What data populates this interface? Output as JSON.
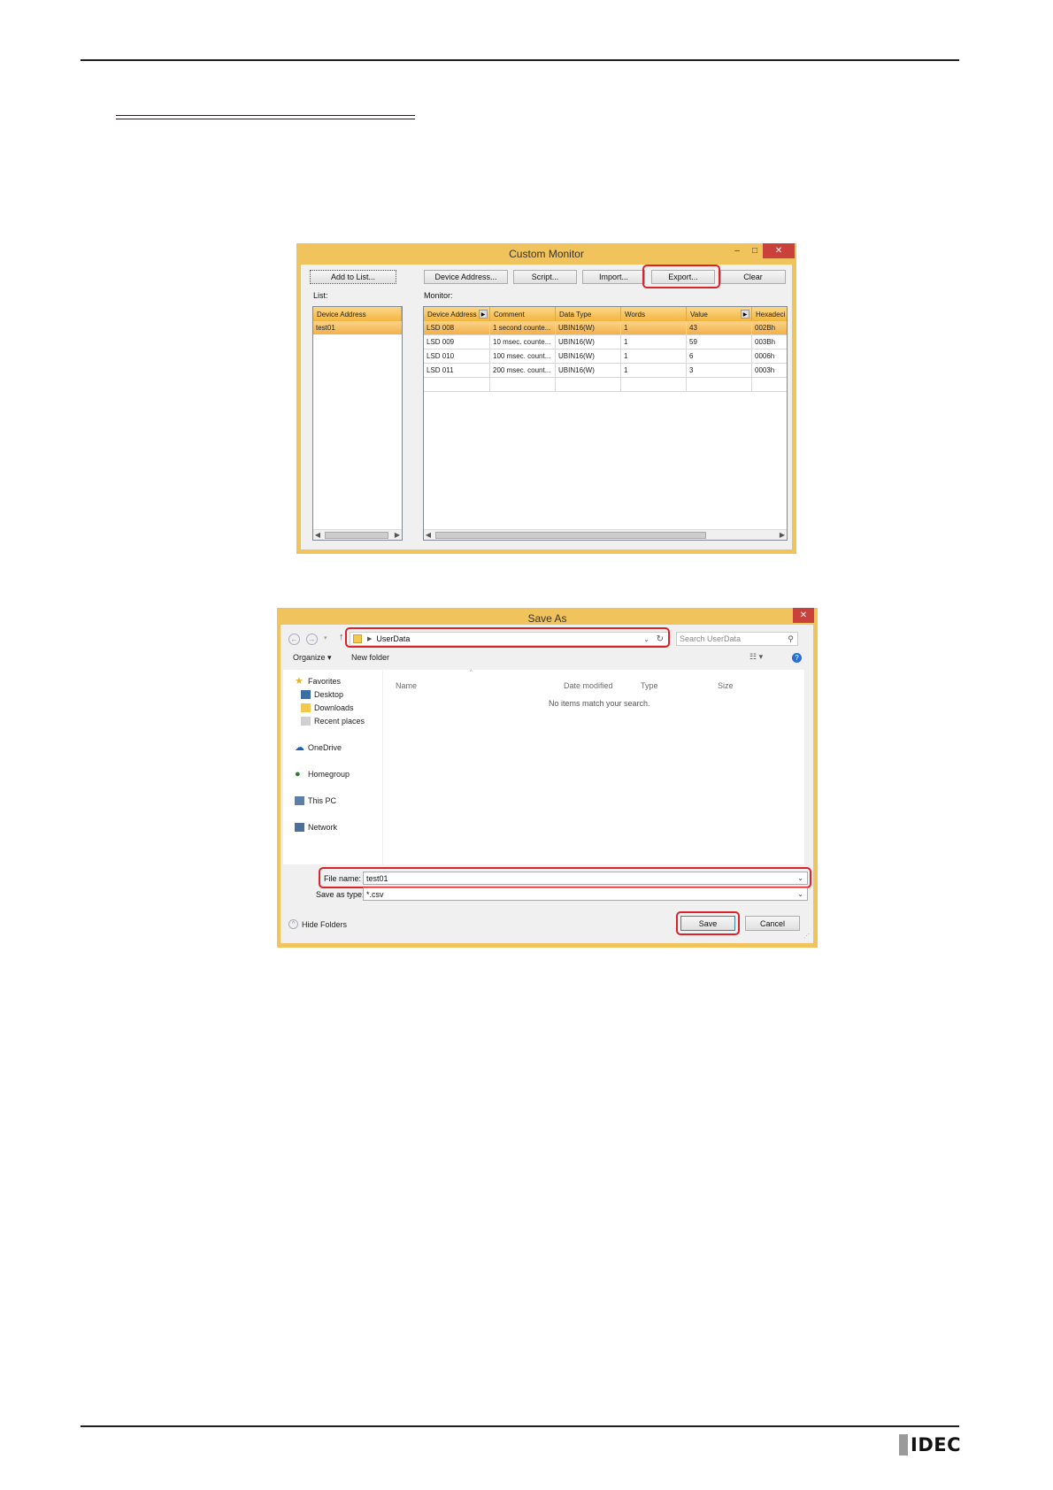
{
  "footer": {
    "logo": "IDEC"
  },
  "custom_monitor": {
    "title": "Custom Monitor",
    "controls": {
      "minimize": "–",
      "maximize": "□",
      "close": "✕"
    },
    "buttons": {
      "add_to_list": "Add to List...",
      "device_address": "Device Address...",
      "script": "Script...",
      "import": "Import...",
      "export": "Export...",
      "clear": "Clear"
    },
    "list_label": "List:",
    "monitor_label": "Monitor:",
    "list_column": "Device Address",
    "list_items": [
      "test01"
    ],
    "columns": [
      "Device Address",
      "Comment",
      "Data Type",
      "Words",
      "Value",
      "Hexadeci"
    ],
    "rows": [
      [
        "LSD 008",
        "1 second counte...",
        "UBIN16(W)",
        "1",
        "43",
        "002Bh"
      ],
      [
        "LSD 009",
        "10 msec. counte...",
        "UBIN16(W)",
        "1",
        "59",
        "003Bh"
      ],
      [
        "LSD 010",
        "100 msec. count...",
        "UBIN16(W)",
        "1",
        "6",
        "0006h"
      ],
      [
        "LSD 011",
        "200 msec. count...",
        "UBIN16(W)",
        "1",
        "3",
        "0003h"
      ]
    ]
  },
  "save_as": {
    "title": "Save As",
    "breadcrumb": "UserData",
    "search_placeholder": "Search UserData",
    "toolbar": {
      "organize": "Organize ▾",
      "new_folder": "New folder"
    },
    "nav": {
      "favorites": "Favorites",
      "desktop": "Desktop",
      "downloads": "Downloads",
      "recent": "Recent places",
      "onedrive": "OneDrive",
      "homegroup": "Homegroup",
      "thispc": "This PC",
      "network": "Network"
    },
    "columns": {
      "name": "Name",
      "date": "Date modified",
      "type": "Type",
      "size": "Size"
    },
    "empty_message": "No items match your search.",
    "file_name_label": "File name:",
    "file_name_value": "test01",
    "save_type_label": "Save as type:",
    "save_type_value": "*.csv",
    "hide_folders": "Hide Folders",
    "save": "Save",
    "cancel": "Cancel"
  }
}
